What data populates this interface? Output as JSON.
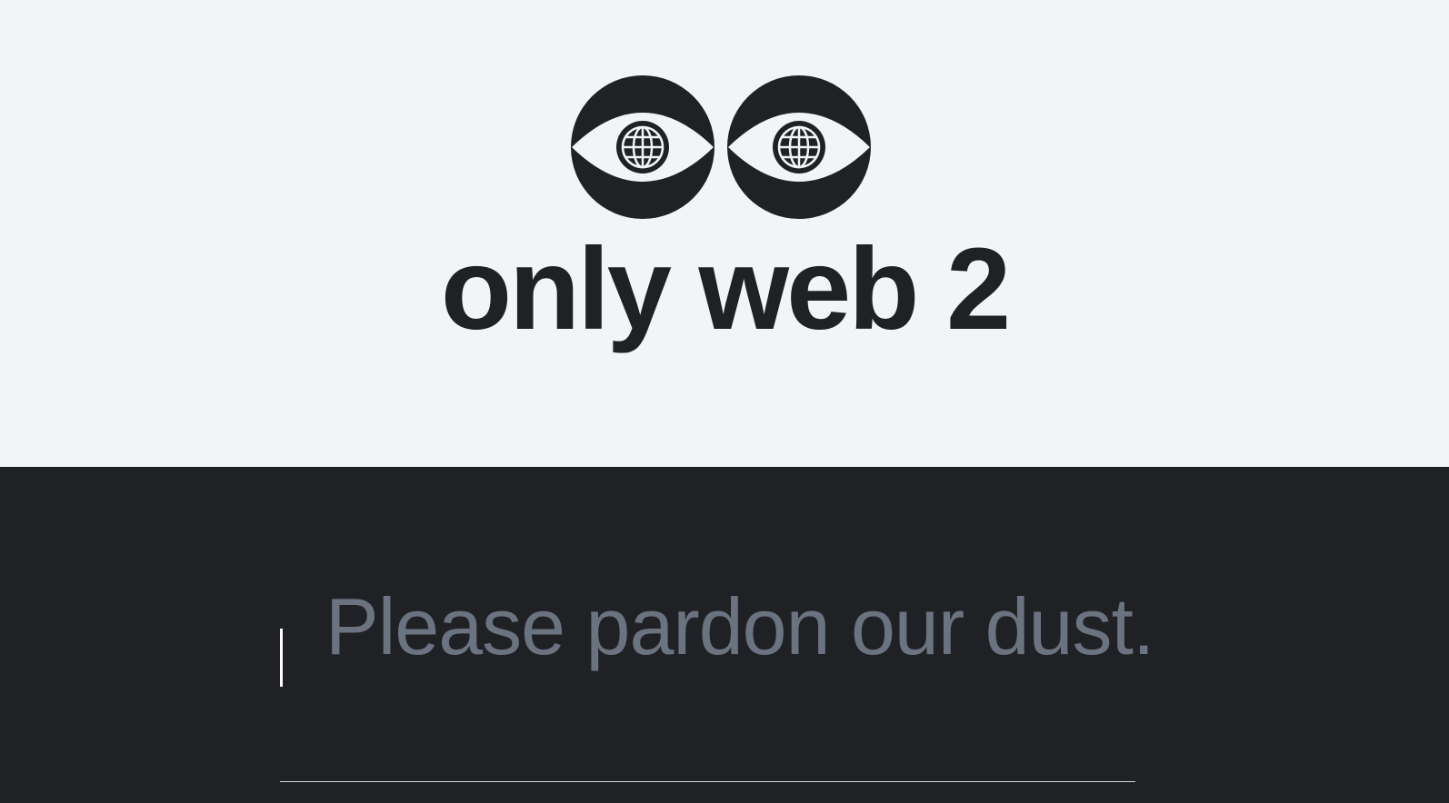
{
  "brand": {
    "name": "only web 2",
    "logo_icon": "twin-eye-globe-icon"
  },
  "main": {
    "message": "Please pardon our dust."
  },
  "colors": {
    "hero_background": "#f3f4f6",
    "content_background": "#202124",
    "ink": "#202124",
    "message_text": "#6b7280",
    "cursor": "#ffffff"
  }
}
